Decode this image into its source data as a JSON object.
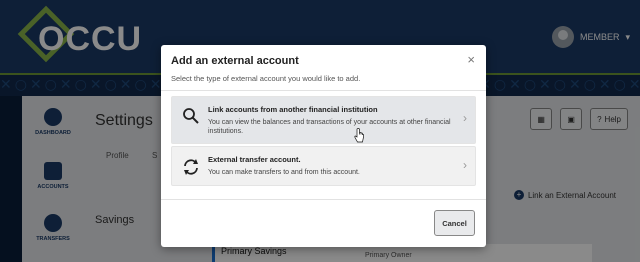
{
  "header": {
    "logo_text": "OCCU",
    "member_label": "MEMBER",
    "member_caret": "▾",
    "pattern": "✕○✕○✕○✕○✕○✕○✕○✕○✕○✕○✕○✕○✕○✕○✕○✕○✕○✕○✕○✕○✕○✕○✕○✕○"
  },
  "sidebar": {
    "items": [
      {
        "label": "DASHBOARD",
        "icon": "dashboard-icon"
      },
      {
        "label": "ACCOUNTS",
        "icon": "wallet-icon"
      },
      {
        "label": "TRANSFERS",
        "icon": "transfers-icon"
      }
    ]
  },
  "page": {
    "title": "Settings",
    "tabs": [
      "Profile",
      "S"
    ],
    "help_label": "Help",
    "section": "Savings",
    "link_external": "Link an External Account",
    "account_name": "Primary Savings",
    "account_owner": "Primary Owner"
  },
  "modal": {
    "title": "Add an external account",
    "close_glyph": "×",
    "subtitle": "Select the type of external account you would like to add.",
    "options": [
      {
        "title": "Link accounts from another financial institution",
        "description": "You can view the balances and transactions of your accounts at other financial institutions.",
        "icon": "search-icon"
      },
      {
        "title": "External transfer account.",
        "description": "You can make transfers to and from this account.",
        "icon": "transfer-arrows-icon"
      }
    ],
    "cancel_label": "Cancel"
  },
  "colors": {
    "brand_navy": "#1a3a66",
    "brand_green": "#8ab64a"
  }
}
